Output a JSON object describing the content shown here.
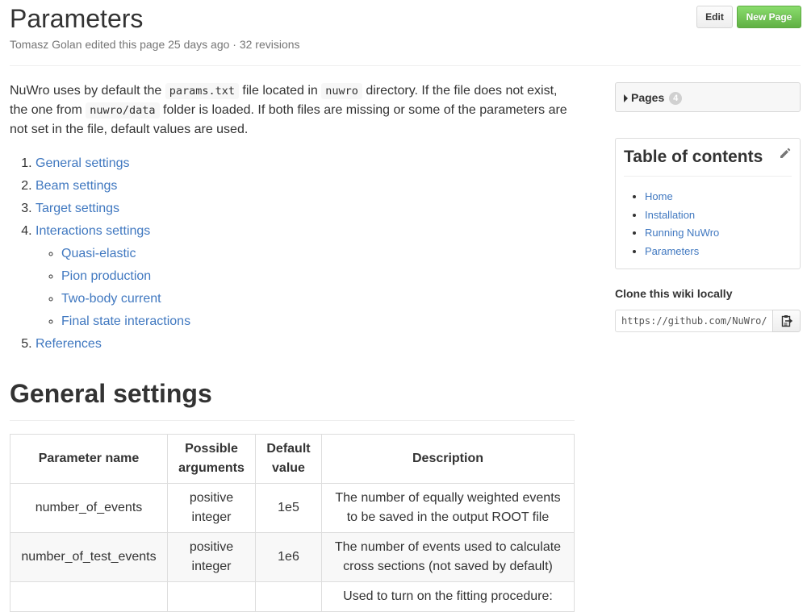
{
  "header": {
    "title": "Parameters",
    "meta": "Tomasz Golan edited this page 25 days ago · 32 revisions",
    "edit_label": "Edit",
    "new_page_label": "New Page"
  },
  "intro": {
    "t1": "NuWro uses by default the ",
    "c1": "params.txt",
    "t2": " file located in ",
    "c2": "nuwro",
    "t3": " directory. If the file does not exist, the one from ",
    "c3": "nuwro/data",
    "t4": " folder is loaded. If both files are missing or some of the parameters are not set in the file, default values are used."
  },
  "toc": {
    "items": [
      "General settings",
      "Beam settings",
      "Target settings",
      "Interactions settings",
      "References"
    ],
    "sub_items": [
      "Quasi-elastic",
      "Pion production",
      "Two-body current",
      "Final state interactions"
    ]
  },
  "section": {
    "title": "General settings"
  },
  "table": {
    "headers": [
      "Parameter name",
      "Possible arguments",
      "Default value",
      "Description"
    ],
    "rows": [
      [
        "number_of_events",
        "positive integer",
        "1e5",
        "The number of equally weighted events to be saved in the output ROOT file"
      ],
      [
        "number_of_test_events",
        "positive integer",
        "1e6",
        "The number of events used to calculate cross sections (not saved by default)"
      ],
      [
        "",
        "",
        "",
        "Used to turn on the fitting procedure:"
      ]
    ]
  },
  "sidebar": {
    "pages_label": "Pages",
    "pages_count": "4",
    "toc_title": "Table of contents",
    "toc_links": [
      "Home",
      "Installation",
      "Running NuWro",
      "Parameters"
    ],
    "clone_title": "Clone this wiki locally",
    "clone_url": "https://github.com/NuWro/nuwro.wiki.git"
  },
  "colors": {
    "link": "#4078c0",
    "new_page_button": "#6cc644",
    "text": "#333333",
    "muted": "#767676"
  },
  "icons": [
    "caret-right-icon",
    "pencil-icon",
    "clipboard-icon"
  ]
}
